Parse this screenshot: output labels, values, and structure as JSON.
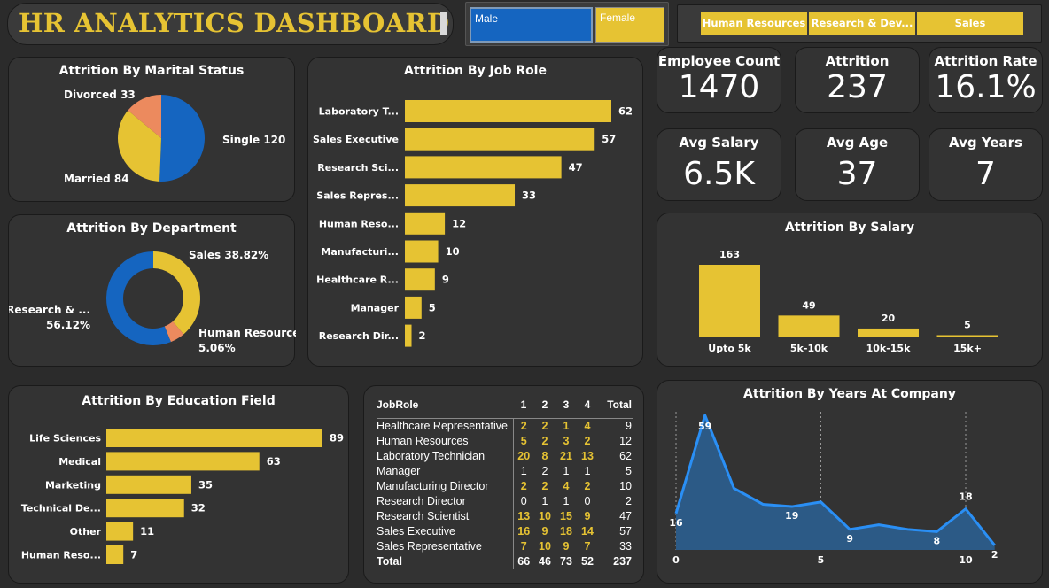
{
  "header": {
    "title": "HR ANALYTICS DASHBOARD"
  },
  "gender_filter": {
    "male": "Male",
    "female": "Female"
  },
  "department_filter": [
    "Human Resources",
    "Research & Dev...",
    "Sales"
  ],
  "kpis": {
    "employee_count": {
      "label": "Employee Count",
      "value": "1470"
    },
    "attrition": {
      "label": "Attrition",
      "value": "237"
    },
    "attrition_rate": {
      "label": "Attrition Rate",
      "value": "16.1%"
    },
    "avg_salary": {
      "label": "Avg Salary",
      "value": "6.5K"
    },
    "avg_age": {
      "label": "Avg Age",
      "value": "37"
    },
    "avg_years": {
      "label": "Avg Years",
      "value": "7"
    }
  },
  "colors": {
    "yellow": "#e6c333",
    "blue": "#1565c0",
    "orange": "#ec8a5e",
    "line_blue": "#2a8ff5",
    "area_fill": "#2c5a86"
  },
  "chart_data": [
    {
      "id": "marital",
      "type": "pie",
      "title": "Attrition By Marital Status",
      "labels": [
        "Single",
        "Married",
        "Divorced"
      ],
      "values": [
        120,
        84,
        33
      ],
      "data_labels": [
        "Single 120",
        "Married 84",
        "Divorced 33"
      ],
      "colors": [
        "#1565c0",
        "#e6c333",
        "#ec8a5e"
      ]
    },
    {
      "id": "department",
      "type": "pie",
      "donut": true,
      "title": "Attrition By Department",
      "labels": [
        "Sales",
        "Human Resources",
        "Research & Development"
      ],
      "values": [
        38.82,
        5.06,
        56.12
      ],
      "data_labels": [
        [
          "Sales 38.82%"
        ],
        [
          "Human Resources",
          "5.06%"
        ],
        [
          "Research & ...",
          "56.12%"
        ]
      ],
      "colors": [
        "#e6c333",
        "#ec8a5e",
        "#1565c0"
      ]
    },
    {
      "id": "jobrole",
      "type": "bar",
      "orientation": "horizontal",
      "title": "Attrition By Job Role",
      "categories": [
        "Laboratory T...",
        "Sales Executive",
        "Research Sci...",
        "Sales Repres...",
        "Human Reso...",
        "Manufacturi...",
        "Healthcare R...",
        "Manager",
        "Research Dir..."
      ],
      "values": [
        62,
        57,
        47,
        33,
        12,
        10,
        9,
        5,
        2
      ]
    },
    {
      "id": "education",
      "type": "bar",
      "orientation": "horizontal",
      "title": "Attrition By Education Field",
      "categories": [
        "Life Sciences",
        "Medical",
        "Marketing",
        "Technical De...",
        "Other",
        "Human Reso..."
      ],
      "values": [
        89,
        63,
        35,
        32,
        11,
        7
      ]
    },
    {
      "id": "salary",
      "type": "bar",
      "orientation": "vertical",
      "title": "Attrition By Salary",
      "categories": [
        "Upto 5k",
        "5k-10k",
        "10k-15k",
        "15k+"
      ],
      "values": [
        163,
        49,
        20,
        5
      ]
    },
    {
      "id": "years",
      "type": "area",
      "title": "Attrition By Years At Company",
      "x": [
        0,
        1,
        2,
        3,
        4,
        5,
        6,
        7,
        8,
        9,
        10,
        11
      ],
      "values": [
        16,
        59,
        27,
        20,
        19,
        21,
        9,
        11,
        9,
        8,
        18,
        2
      ],
      "labeled_points": [
        0,
        1,
        4,
        6,
        9,
        10,
        11
      ],
      "xticks": [
        0,
        5,
        10
      ],
      "gridlines_x": [
        0,
        5,
        10
      ]
    },
    {
      "id": "table",
      "type": "table",
      "columns": [
        "JobRole",
        "1",
        "2",
        "3",
        "4",
        "Total"
      ],
      "rows": [
        [
          "Healthcare Representative",
          "2",
          "2",
          "1",
          "4",
          "9"
        ],
        [
          "Human Resources",
          "5",
          "2",
          "3",
          "2",
          "12"
        ],
        [
          "Laboratory Technician",
          "20",
          "8",
          "21",
          "13",
          "62"
        ],
        [
          "Manager",
          "1",
          "2",
          "1",
          "1",
          "5"
        ],
        [
          "Manufacturing Director",
          "2",
          "2",
          "4",
          "2",
          "10"
        ],
        [
          "Research Director",
          "0",
          "1",
          "1",
          "0",
          "2"
        ],
        [
          "Research Scientist",
          "13",
          "10",
          "15",
          "9",
          "47"
        ],
        [
          "Sales Executive",
          "16",
          "9",
          "18",
          "14",
          "57"
        ],
        [
          "Sales Representative",
          "7",
          "10",
          "9",
          "7",
          "33"
        ]
      ],
      "total_row": [
        "Total",
        "66",
        "46",
        "73",
        "52",
        "237"
      ]
    }
  ]
}
